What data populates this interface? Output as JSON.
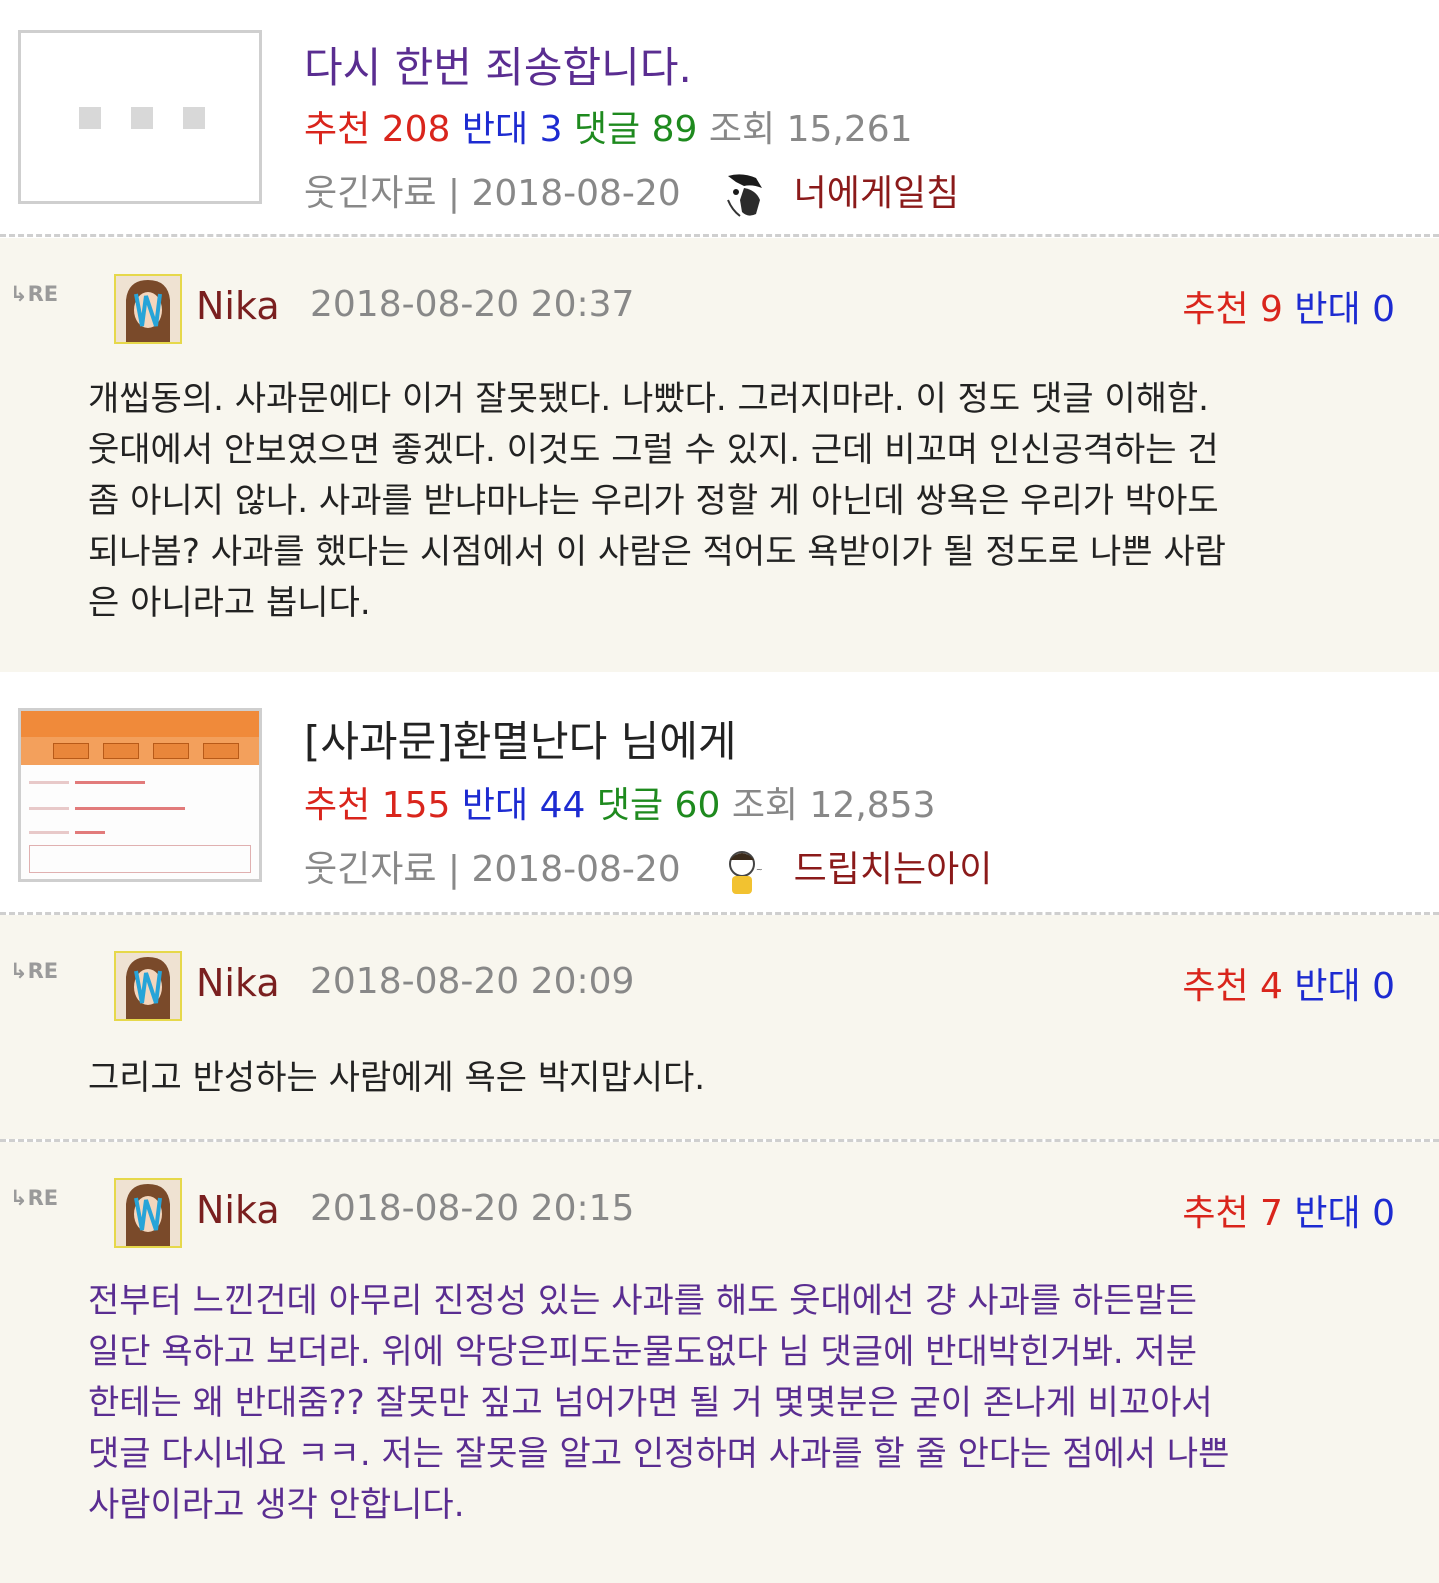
{
  "posts": [
    {
      "title": "다시 한번 죄송합니다.",
      "up_label": "추천",
      "up": "208",
      "down_label": "반대",
      "down": "3",
      "reply_label": "댓글",
      "replies": "89",
      "view_label": "조회",
      "views": "15,261",
      "meta": "웃긴자료 | 2018-08-20",
      "author": "너에게일침",
      "author_icon": "face-sketch-icon"
    },
    {
      "title": "[사과문]환멸난다 님에게",
      "up_label": "추천",
      "up": "155",
      "down_label": "반대",
      "down": "44",
      "reply_label": "댓글",
      "replies": "60",
      "view_label": "조회",
      "views": "12,853",
      "meta": "웃긴자료 | 2018-08-20",
      "author": "드립치는아이",
      "author_icon": "kid-drawing-icon"
    }
  ],
  "comments": [
    {
      "re": "RE",
      "name": "Nika",
      "date": "2018-08-20 20:37",
      "up_label": "추천",
      "up": "9",
      "down_label": "반대",
      "down": "0",
      "body": "개씹동의. 사과문에다 이거 잘못됐다. 나빴다. 그러지마라. 이 정도 댓글 이해함.\n웃대에서 안보였으면 좋겠다. 이것도 그럴 수 있지. 근데 비꼬며 인신공격하는 건\n좀 아니지 않나. 사과를 받냐마냐는 우리가 정할 게 아닌데 쌍욕은 우리가 박아도\n되나봄? 사과를 했다는 시점에서 이 사람은 적어도 욕받이가 될 정도로 나쁜 사람\n은 아니라고 봅니다."
    },
    {
      "re": "RE",
      "name": "Nika",
      "date": "2018-08-20 20:09",
      "up_label": "추천",
      "up": "4",
      "down_label": "반대",
      "down": "0",
      "body": "그리고 반성하는 사람에게 욕은 박지맙시다."
    },
    {
      "re": "RE",
      "name": "Nika",
      "date": "2018-08-20 20:15",
      "up_label": "추천",
      "up": "7",
      "down_label": "반대",
      "down": "0",
      "body": "전부터 느낀건데 아무리 진정성 있는 사과를 해도 웃대에선 걍 사과를 하든말든\n일단 욕하고 보더라. 위에 악당은피도눈물도없다 님 댓글에 반대박힌거봐. 저분\n한테는 왜 반대줌?? 잘못만 짚고 넘어가면 될 거 몇몇분은 굳이 존나게 비꼬아서\n댓글 다시네요 ㅋㅋ. 저는 잘못을 알고 인정하며 사과를 할 줄 안다는 점에서 나쁜\n사람이라고 생각 안합니다."
    }
  ]
}
